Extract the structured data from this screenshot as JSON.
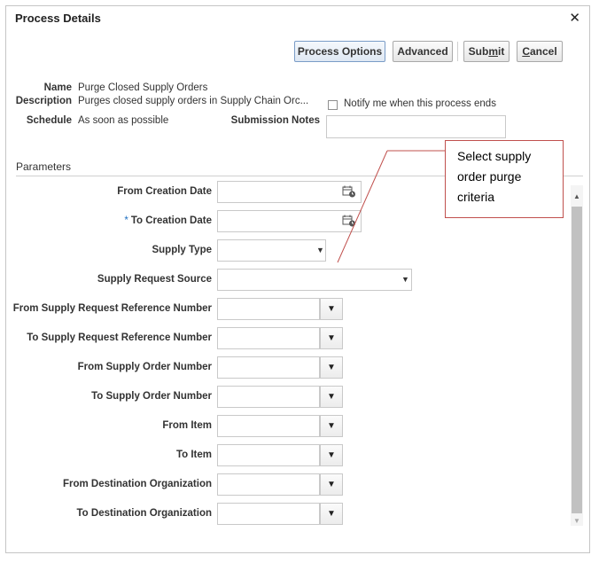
{
  "dialog": {
    "title": "Process Details",
    "close_symbol": "✕"
  },
  "toolbar": {
    "process_options": "Process Options",
    "advanced": "Advanced",
    "submit_pre": "Sub",
    "submit_u": "m",
    "submit_post": "it",
    "cancel_u": "C",
    "cancel_post": "ancel"
  },
  "info": {
    "name_label": "Name",
    "name_value": "Purge Closed Supply Orders",
    "description_label": "Description",
    "description_value": "Purges closed supply orders in Supply Chain Orc...",
    "schedule_label": "Schedule",
    "schedule_value": "As soon as possible",
    "notify_label": "Notify me when this process ends",
    "submission_notes_label": "Submission Notes",
    "submission_notes_value": ""
  },
  "parameters": {
    "title": "Parameters",
    "required_marker": "*",
    "fields": [
      {
        "label": "From Creation Date",
        "value": ""
      },
      {
        "label": "To Creation Date",
        "value": ""
      },
      {
        "label": "Supply Type",
        "value": ""
      },
      {
        "label": "Supply Request Source",
        "value": ""
      },
      {
        "label": "From Supply Request Reference Number",
        "value": ""
      },
      {
        "label": "To Supply Request Reference Number",
        "value": ""
      },
      {
        "label": "From Supply Order Number",
        "value": ""
      },
      {
        "label": "To Supply Order Number",
        "value": ""
      },
      {
        "label": "From Item",
        "value": ""
      },
      {
        "label": "To Item",
        "value": ""
      },
      {
        "label": "From Destination Organization",
        "value": ""
      },
      {
        "label": "To Destination Organization",
        "value": ""
      }
    ]
  },
  "callout": {
    "text": "Select supply order purge criteria"
  },
  "icons": {
    "calendar": "calendar-icon",
    "dropdown": "chevron-down-icon",
    "lov": "caret-down-icon"
  },
  "colors": {
    "callout_border": "#c0504d",
    "required_marker": "#1f6fc1",
    "primary_button_border": "#7a9cc7"
  }
}
